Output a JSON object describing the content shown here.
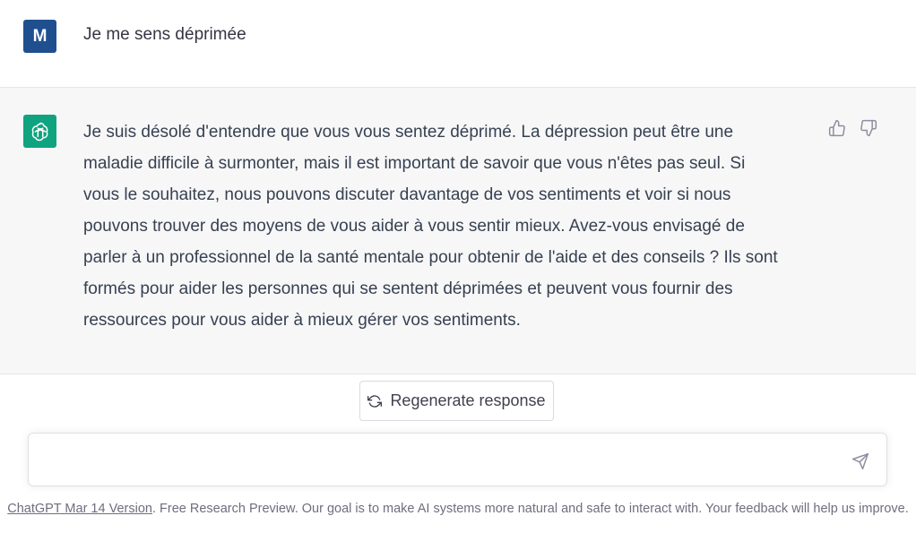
{
  "user_message": {
    "avatar_letter": "M",
    "text": "Je me sens déprimée"
  },
  "assistant_message": {
    "avatar_icon": "openai-logo-icon",
    "lines": [
      "Je suis désolé d'entendre que vous vous sentez déprimé. La dépression peut être une",
      "maladie difficile à surmonter, mais il est important de savoir que vous n'êtes pas seul. Si",
      "vous le souhaitez, nous pouvons discuter davantage de vos sentiments et voir si nous",
      "pouvons trouver des moyens de vous aider à vous sentir mieux. Avez-vous envisagé de",
      "parler à un professionnel de la santé mentale pour obtenir de l'aide et des conseils ? Ils sont",
      "formés pour aider les personnes qui se sentent déprimées et peuvent vous fournir des",
      "ressources pour vous aider à mieux gérer vos sentiments."
    ],
    "feedback_icons": [
      "thumbs-up-icon",
      "thumbs-down-icon"
    ]
  },
  "regenerate": {
    "label": "Regenerate response",
    "icon": "refresh-icon"
  },
  "input": {
    "value": "",
    "placeholder": "",
    "send_icon": "send-icon"
  },
  "footer": {
    "link_text": "ChatGPT Mar 14 Version",
    "text": ". Free Research Preview. Our goal is to make AI systems more natural and safe to interact with. Your feedback will help us improve."
  },
  "colors": {
    "user_avatar": "#1f4f8f",
    "bot_avatar": "#10a37f",
    "bot_row_bg": "#f7f7f8"
  }
}
